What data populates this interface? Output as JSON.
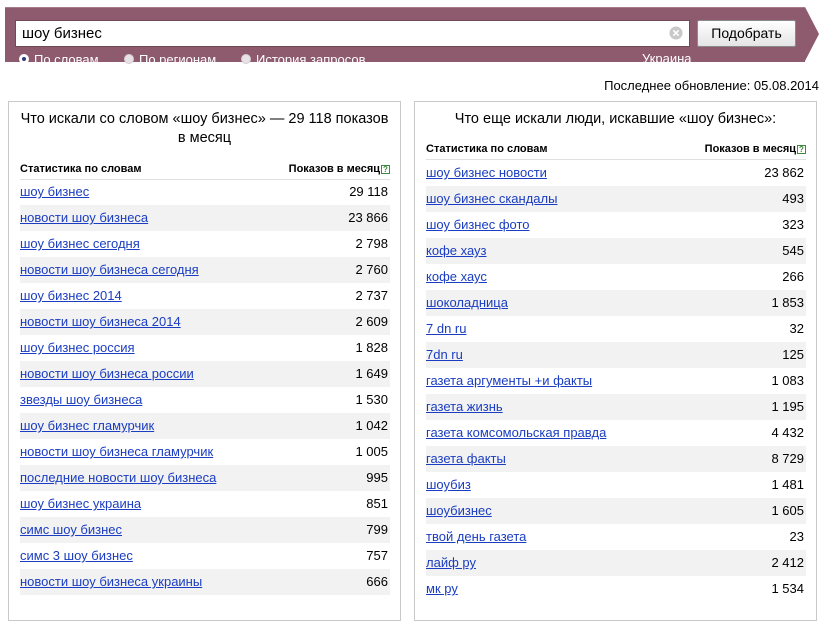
{
  "search": {
    "query": "шоу бизнес",
    "submit_label": "Подобрать",
    "modes": [
      {
        "label": "По словам",
        "checked": true
      },
      {
        "label": "По регионам",
        "checked": false
      },
      {
        "label": "История запросов",
        "checked": false
      }
    ],
    "region": "Украина"
  },
  "colors": {
    "header_band": "#8d5a6e",
    "link": "#1a3dc1",
    "row_shade": "#f2f2f2"
  },
  "last_update": "Последнее обновление: 05.08.2014",
  "left_panel": {
    "title": "Что искали со словом «шоу бизнес» — 29 118 показов в месяц",
    "col_keyword": "Статистика по словам",
    "col_count": "Показов в месяц",
    "rows": [
      {
        "keyword": "шоу бизнес",
        "count": "29 118"
      },
      {
        "keyword": "новости шоу бизнеса",
        "count": "23 866"
      },
      {
        "keyword": "шоу бизнес сегодня",
        "count": "2 798"
      },
      {
        "keyword": "новости шоу бизнеса сегодня",
        "count": "2 760"
      },
      {
        "keyword": "шоу бизнес 2014",
        "count": "2 737"
      },
      {
        "keyword": "новости шоу бизнеса 2014",
        "count": "2 609"
      },
      {
        "keyword": "шоу бизнес россия",
        "count": "1 828"
      },
      {
        "keyword": "новости шоу бизнеса россии",
        "count": "1 649"
      },
      {
        "keyword": "звезды шоу бизнеса",
        "count": "1 530"
      },
      {
        "keyword": "шоу бизнес гламурчик",
        "count": "1 042"
      },
      {
        "keyword": "новости шоу бизнеса гламурчик",
        "count": "1 005"
      },
      {
        "keyword": "последние новости шоу бизнеса",
        "count": "995"
      },
      {
        "keyword": "шоу бизнес украина",
        "count": "851"
      },
      {
        "keyword": "симс шоу бизнес",
        "count": "799"
      },
      {
        "keyword": "симс 3 шоу бизнес",
        "count": "757"
      },
      {
        "keyword": "новости шоу бизнеса украины",
        "count": "666"
      }
    ]
  },
  "right_panel": {
    "title": "Что еще искали люди, искавшие «шоу бизнес»:",
    "col_keyword": "Статистика по словам",
    "col_count": "Показов в месяц",
    "rows": [
      {
        "keyword": "шоу бизнес новости",
        "count": "23 862"
      },
      {
        "keyword": "шоу бизнес скандалы",
        "count": "493"
      },
      {
        "keyword": "шоу бизнес фото",
        "count": "323"
      },
      {
        "keyword": "кофе хауз",
        "count": "545"
      },
      {
        "keyword": "кофе хаус",
        "count": "266"
      },
      {
        "keyword": "шоколадница",
        "count": "1 853"
      },
      {
        "keyword": "7 dn ru",
        "count": "32"
      },
      {
        "keyword": "7dn ru",
        "count": "125"
      },
      {
        "keyword": "газета аргументы +и факты",
        "count": "1 083"
      },
      {
        "keyword": "газета жизнь",
        "count": "1 195"
      },
      {
        "keyword": "газета комсомольская правда",
        "count": "4 432"
      },
      {
        "keyword": "газета факты",
        "count": "8 729"
      },
      {
        "keyword": "шоубиз",
        "count": "1 481"
      },
      {
        "keyword": "шоубизнес",
        "count": "1 605"
      },
      {
        "keyword": "твой день газета",
        "count": "23"
      },
      {
        "keyword": "лайф ру",
        "count": "2 412"
      },
      {
        "keyword": "мк ру",
        "count": "1 534"
      }
    ]
  }
}
